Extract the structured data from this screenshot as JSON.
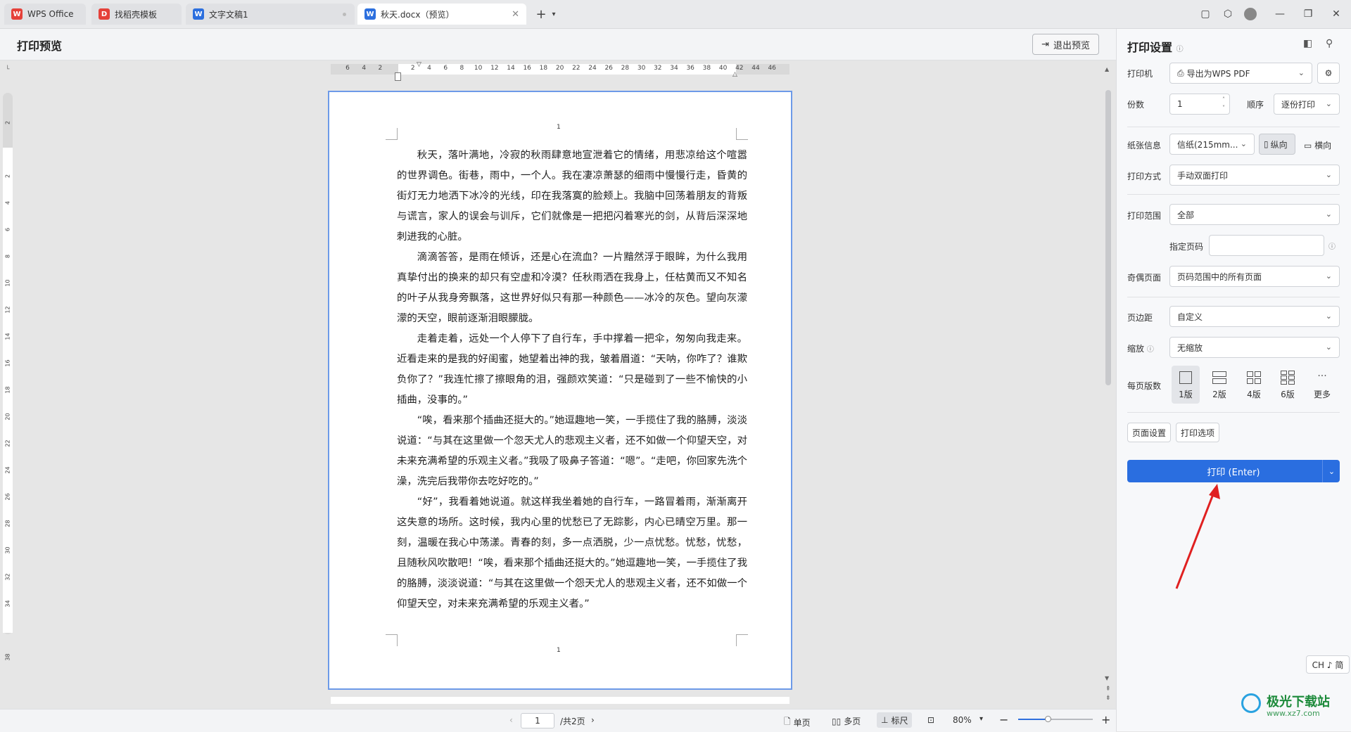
{
  "tabs": [
    {
      "label": "WPS Office",
      "icon": "wps-logo-icon",
      "color": "#e5413a"
    },
    {
      "label": "找稻壳模板",
      "icon": "docer-icon",
      "color": "#e5413a"
    },
    {
      "label": "文字文稿1",
      "icon": "writer-doc-icon",
      "color": "#2c6fde"
    },
    {
      "label": "秋天.docx（预览）",
      "icon": "writer-doc-icon",
      "color": "#2c6fde"
    }
  ],
  "toolbar": {
    "title": "打印预览",
    "exit_label": "退出预览"
  },
  "ruler": {
    "h_ticks": [
      "6",
      "4",
      "2",
      "",
      "2",
      "4",
      "6",
      "8",
      "10",
      "12",
      "14",
      "16",
      "18",
      "20",
      "22",
      "24",
      "26",
      "28",
      "30",
      "32",
      "34",
      "36",
      "38",
      "40",
      "42",
      "44",
      "46"
    ],
    "v_ticks": [
      "2",
      "",
      "2",
      "4",
      "6",
      "8",
      "10",
      "12",
      "14",
      "16",
      "18",
      "20",
      "22",
      "24",
      "26",
      "28",
      "30",
      "32",
      "34",
      "",
      "38"
    ]
  },
  "document": {
    "header_page_number": "1",
    "footer_page_number": "1",
    "paragraphs": [
      "秋天，落叶满地，冷寂的秋雨肆意地宣泄着它的情绪，用悲凉给这个喧嚣的世界调色。街巷，雨中，一个人。我在凄凉萧瑟的细雨中慢慢行走，昏黄的街灯无力地洒下冰冷的光线，印在我落寞的脸颊上。我脑中回荡着朋友的背叛与谎言，家人的误会与训斥，它们就像是一把把闪着寒光的剑，从背后深深地刺进我的心脏。",
      "滴滴答答，是雨在倾诉，还是心在流血？一片黯然浮于眼眸，为什么我用真挚付出的换来的却只有空虚和冷漠？任秋雨洒在我身上，任枯黄而又不知名的叶子从我身旁飘落，这世界好似只有那一种颜色——冰冷的灰色。望向灰濛濛的天空，眼前逐渐泪眼朦胧。",
      "走着走着，远处一个人停下了自行车，手中撑着一把伞，匆匆向我走来。近看走来的是我的好闺蜜，她望着出神的我，皱着眉道：“天呐，你咋了？谁欺负你了？”我连忙擦了擦眼角的泪，强颜欢笑道：“只是碰到了一些不愉快的小插曲，没事的。”",
      "“唉，看来那个插曲还挺大的。”她逗趣地一笑，一手揽住了我的胳膊，淡淡说道：“与其在这里做一个忽天尤人的悲观主义者，还不如做一个仰望天空，对未来充满希望的乐观主义者。”我吸了吸鼻子答道：“嗯”。“走吧，你回家先洗个澡，洗完后我带你去吃好吃的。”",
      "“好”，我看着她说道。就这样我坐着她的自行车，一路冒着雨，渐渐离开这失意的场所。这时候，我内心里的忧愁已了无踪影，内心已晴空万里。那一刻，温暖在我心中荡漾。青春的刻，多一点洒脱，少一点忧愁。忧愁，忧愁，且随秋风吹散吧！“唉，看来那个插曲还挺大的。”她逗趣地一笑，一手揽住了我的胳膊，淡淡说道：“与其在这里做一个怨天尤人的悲观主义者，还不如做一个仰望天空，对未来充满希望的乐观主义者。”"
    ]
  },
  "status": {
    "page_current": "1",
    "page_total": "/共2页",
    "single_label": "单页",
    "multi_label": "多页",
    "ruler_label": "标尺",
    "zoom": "80%",
    "zoom_fraction": 0.4
  },
  "panel": {
    "title": "打印设置",
    "printer_label": "打印机",
    "printer_value": "导出为WPS PDF",
    "copies_label": "份数",
    "copies_value": "1",
    "order_label": "顺序",
    "order_value": "逐份打印",
    "paper_label": "纸张信息",
    "paper_value": "信纸(215mm...",
    "portrait_label": "纵向",
    "landscape_label": "横向",
    "method_label": "打印方式",
    "method_value": "手动双面打印",
    "range_label": "打印范围",
    "range_value": "全部",
    "pages_label": "指定页码",
    "pages_value": "",
    "oddeven_label": "奇偶页面",
    "oddeven_value": "页码范围中的所有页面",
    "margin_label": "页边距",
    "margin_value": "自定义",
    "scale_label": "缩放",
    "scale_value": "无缩放",
    "perpage_label": "每页版数",
    "layouts": [
      "1版",
      "2版",
      "4版",
      "6版",
      "更多"
    ],
    "page_setup_label": "页面设置",
    "print_options_label": "打印选项",
    "print_button_label": "打印 (Enter)"
  },
  "ime": {
    "label": "CH ♪ 简"
  },
  "watermark": {
    "text": "极光下载站",
    "url": "www.xz7.com"
  },
  "colors": {
    "accent": "#2a6ee0",
    "page_border": "#6d9ae8",
    "arrow": "#e02020"
  }
}
